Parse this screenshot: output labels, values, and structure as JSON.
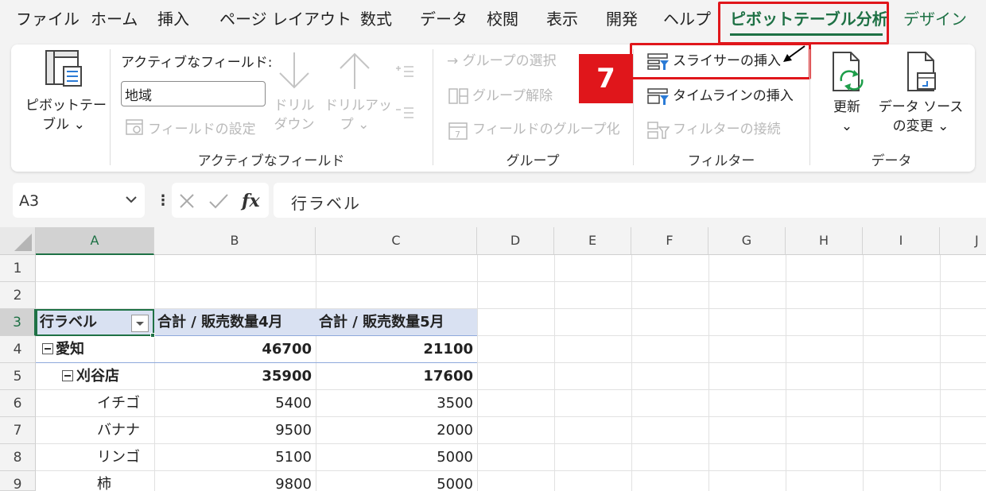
{
  "tabs": [
    {
      "label": "ファイル"
    },
    {
      "label": "ホーム"
    },
    {
      "label": "挿入"
    },
    {
      "label": "ページ レイアウト"
    },
    {
      "label": "数式"
    },
    {
      "label": "データ"
    },
    {
      "label": "校閲"
    },
    {
      "label": "表示"
    },
    {
      "label": "開発"
    },
    {
      "label": "ヘルプ"
    },
    {
      "label": "ピボットテーブル分析"
    },
    {
      "label": "デザイン"
    }
  ],
  "ribbon": {
    "pivottable": {
      "line1": "ピボットテー",
      "line2": "ブル ⌄"
    },
    "active_field": {
      "label": "アクティブなフィールド:",
      "value": "地域",
      "field_settings": "フィールドの設定",
      "drill_down_1": "ドリル",
      "drill_down_2": "ダウン",
      "drill_up_1": "ドリルアッ",
      "drill_up_2": "プ ⌄",
      "group_label": "アクティブなフィールド"
    },
    "group": {
      "group_selection": "→ グループの選択",
      "ungroup": "グループ解除",
      "group_field": "フィールドのグループ化",
      "group_label": "グループ"
    },
    "filter": {
      "insert_slicer": "スライサーの挿入",
      "insert_timeline": "タイムラインの挿入",
      "filter_connections": "フィルターの接続",
      "group_label": "フィルター"
    },
    "data": {
      "refresh_1": "更新",
      "refresh_2": "⌄",
      "change_source_1": "データ ソース",
      "change_source_2": "の変更 ⌄",
      "group_label": "データ"
    },
    "step_badge": "7"
  },
  "formula_bar": {
    "name_box": "A3",
    "formula": "行ラベル"
  },
  "columns": [
    "A",
    "B",
    "C",
    "D",
    "E",
    "F",
    "G",
    "H",
    "I",
    "J"
  ],
  "rows": [
    "1",
    "2",
    "3",
    "4",
    "5",
    "6",
    "7",
    "8",
    "9"
  ],
  "pivot": {
    "header_row_label": "行ラベル",
    "header_col_b": "合計 / 販売数量4月",
    "header_col_c": "合計 / 販売数量5月",
    "rows": [
      {
        "label": "愛知",
        "b": "46700",
        "c": "21100"
      },
      {
        "label": "刈谷店",
        "b": "35900",
        "c": "17600"
      },
      {
        "label": "イチゴ",
        "b": "5400",
        "c": "3500"
      },
      {
        "label": "バナナ",
        "b": "9500",
        "c": "2000"
      },
      {
        "label": "リンゴ",
        "b": "5100",
        "c": "5000"
      },
      {
        "label": "柿",
        "b": "9800",
        "c": "5000"
      }
    ]
  },
  "colors": {
    "accent": "#1e7145",
    "highlight": "#e0161b",
    "pivot_header": "#d9e1f2"
  }
}
